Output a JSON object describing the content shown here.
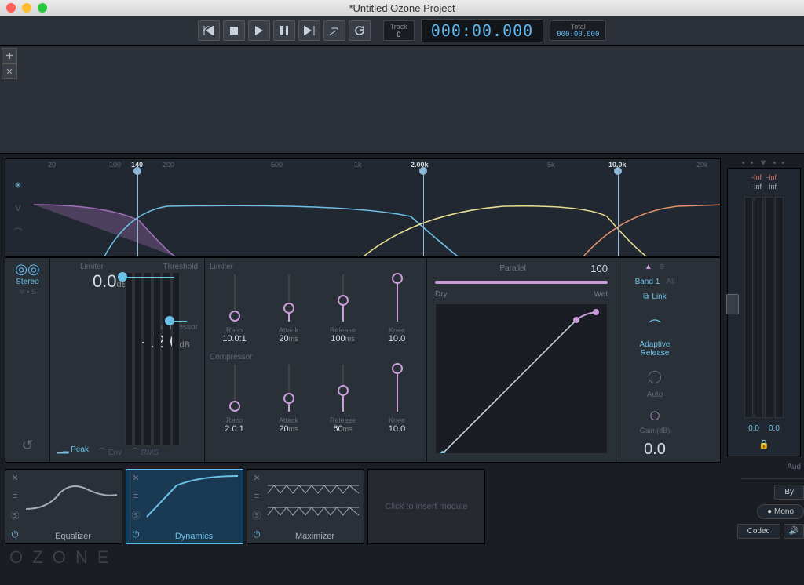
{
  "window": {
    "title": "*Untitled Ozone Project"
  },
  "transport": {
    "track_label": "Track",
    "track_value": "0",
    "time": "000:00.000",
    "total_label": "Total",
    "total_value": "000:00.000"
  },
  "spectrum": {
    "freqs": [
      "20",
      "100",
      "140",
      "200",
      "500",
      "1k",
      "2.00k",
      "5k",
      "10.0k",
      "20k"
    ],
    "crossovers": [
      {
        "value": "140",
        "pos": 168
      },
      {
        "value": "2.00k",
        "pos": 532
      },
      {
        "value": "10.0k",
        "pos": 780
      }
    ]
  },
  "dynamics": {
    "stereo": {
      "label": "Stereo",
      "ms": "M • S"
    },
    "limiter": {
      "threshold_label": "Threshold",
      "limiter_heading": "Limiter",
      "value": "0.0",
      "unit": "dB"
    },
    "compressor": {
      "label": "Compressor",
      "value": "-12.0",
      "unit": "dB"
    },
    "detectors": {
      "peak": "Peak",
      "env": "Env",
      "rms": "RMS"
    },
    "lim_section": {
      "heading": "Limiter",
      "ratio_label": "Ratio",
      "ratio": "10.0:1",
      "attack_label": "Attack",
      "attack": "20",
      "attack_unit": "ms",
      "release_label": "Release",
      "release": "100",
      "release_unit": "ms",
      "knee_label": "Knee",
      "knee": "10.0"
    },
    "comp_section": {
      "heading": "Compressor",
      "ratio_label": "Ratio",
      "ratio": "2.0:1",
      "attack_label": "Attack",
      "attack": "20",
      "attack_unit": "ms",
      "release_label": "Release",
      "release": "60",
      "release_unit": "ms",
      "knee_label": "Knee",
      "knee": "10.0"
    },
    "parallel": {
      "label": "Parallel",
      "value": "100",
      "dry": "Dry",
      "wet": "Wet"
    },
    "band": {
      "band1": "Band 1",
      "all": "All",
      "link": "Link",
      "adaptive": "Adaptive\nRelease",
      "auto": "Auto",
      "gain_label": "Gain (dB)",
      "gain": "0.0"
    }
  },
  "meters": {
    "inf": "-Inf",
    "zero": "0.0",
    "audio_label": "Aud"
  },
  "modules": {
    "eq": "Equalizer",
    "dyn": "Dynamics",
    "max": "Maximizer",
    "insert": "Click to insert module"
  },
  "right": {
    "by": "By",
    "mono": "Mono",
    "codec": "Codec"
  },
  "logo": "O Z O N E"
}
